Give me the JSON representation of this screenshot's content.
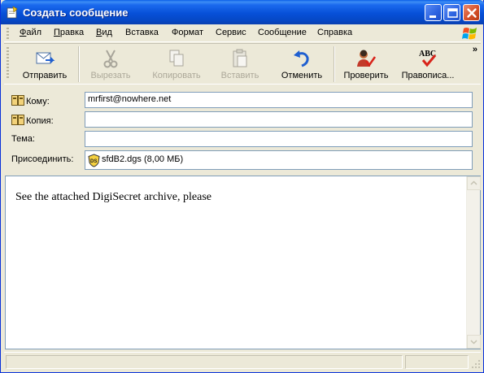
{
  "window": {
    "title": "Создать сообщение",
    "colors": {
      "titlebar": "#0750d8",
      "close_button": "#d6502a",
      "face": "#ece9d8"
    }
  },
  "menu": {
    "items": [
      {
        "label": "Файл",
        "accel": "Ф"
      },
      {
        "label": "Правка",
        "accel": "П"
      },
      {
        "label": "Вид",
        "accel": "В"
      },
      {
        "label": "Вставка",
        "accel": "с"
      },
      {
        "label": "Формат",
        "accel": "о"
      },
      {
        "label": "Сервис",
        "accel": "С"
      },
      {
        "label": "Сообщение",
        "accel": "б"
      },
      {
        "label": "Справка",
        "accel": "С"
      }
    ]
  },
  "toolbar": {
    "send": "Отправить",
    "cut": "Вырезать",
    "copy": "Копировать",
    "paste": "Вставить",
    "undo": "Отменить",
    "check": "Проверить",
    "spelling": "Правописа...",
    "spelling_icon_text": "ABC",
    "overflow": "»"
  },
  "header": {
    "to_label": "Кому:",
    "to_value": "mrfirst@nowhere.net",
    "cc_label": "Копия:",
    "cc_value": "",
    "subject_label": "Тема:",
    "subject_value": "",
    "attach_label": "Присоединить:",
    "attachment": "sfdB2.dgs (8,00 МБ)",
    "attachment_icon_text": "DS"
  },
  "body": {
    "text": "See the attached DigiSecret archive, please"
  }
}
